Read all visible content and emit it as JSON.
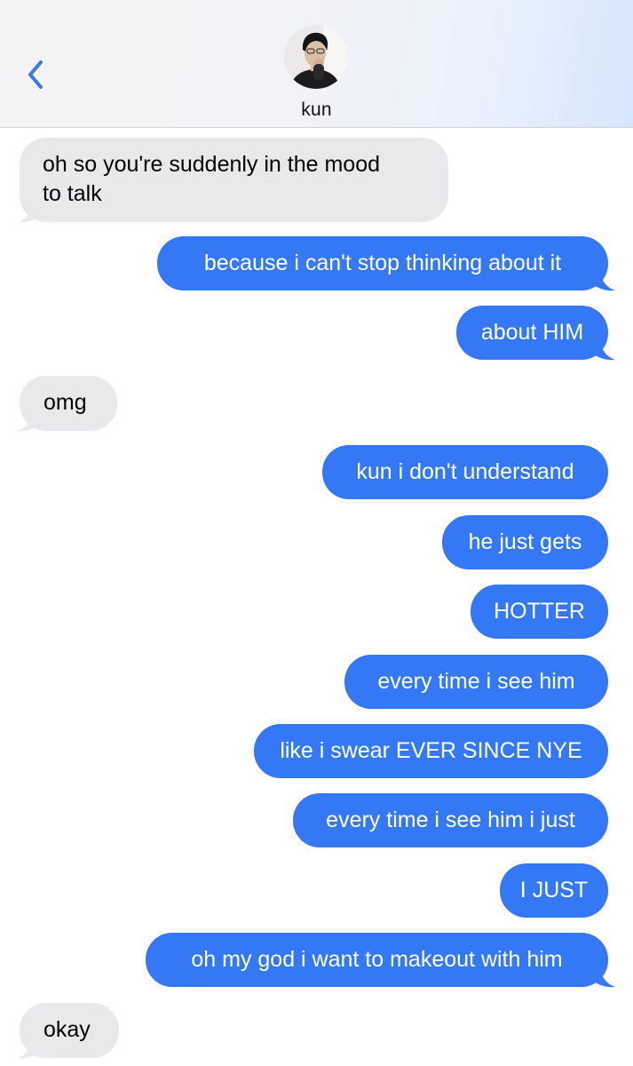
{
  "header": {
    "contact_name": "kun",
    "back_icon": "chevron-left-icon",
    "accent_color": "#3478f6"
  },
  "messages": [
    {
      "from": "contact",
      "text": "oh so you're suddenly in the mood to talk",
      "lines": [
        "oh so you're suddenly in the mood",
        "to talk"
      ]
    },
    {
      "from": "me",
      "text": "because i can't stop thinking about it"
    },
    {
      "from": "me",
      "text": "about HIM"
    },
    {
      "from": "contact",
      "text": "omg"
    },
    {
      "from": "me",
      "text": "kun i don't understand"
    },
    {
      "from": "me",
      "text": "he just gets"
    },
    {
      "from": "me",
      "text": "HOTTER"
    },
    {
      "from": "me",
      "text": "every time i see him"
    },
    {
      "from": "me",
      "text": "like i swear EVER SINCE NYE"
    },
    {
      "from": "me",
      "text": "every time i see him i just"
    },
    {
      "from": "me",
      "text": "I JUST"
    },
    {
      "from": "me",
      "text": "oh my god i want to makeout with him"
    },
    {
      "from": "contact",
      "text": "okay"
    }
  ]
}
